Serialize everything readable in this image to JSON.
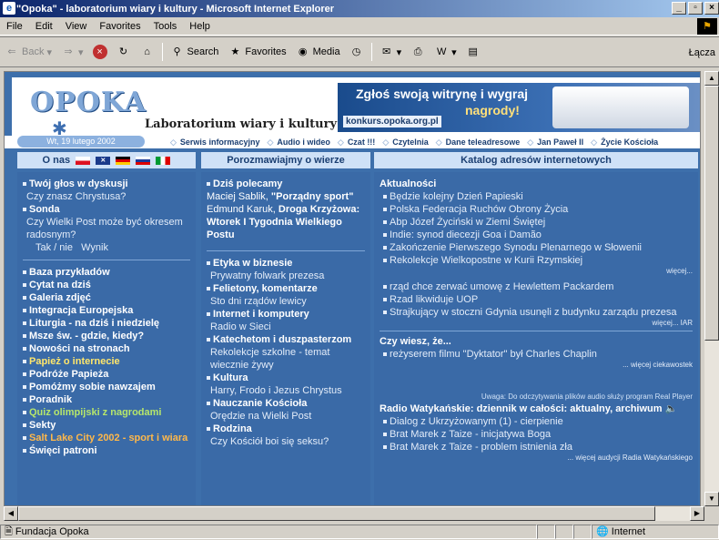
{
  "window": {
    "title": "\"Opoka\" - laboratorium wiary i kultury - Microsoft Internet Explorer",
    "buttons": [
      "_",
      "̅",
      "×"
    ]
  },
  "menubar": [
    "File",
    "Edit",
    "View",
    "Favorites",
    "Tools",
    "Help"
  ],
  "toolbar": {
    "back": "Back",
    "search": "Search",
    "favorites": "Favorites",
    "media": "Media",
    "links": "Łącza"
  },
  "statusbar": {
    "text": "Fundacja Opoka",
    "zone": "Internet"
  },
  "header": {
    "logo": "OPOKA",
    "subtitle": "Laboratorium wiary i kultury",
    "banner_line1": "Zgłoś swoją witrynę i wygraj",
    "banner_line2": "nagrody!",
    "banner_url": "konkurs.opoka.org.pl",
    "date": "Wt, 19 lutego 2002"
  },
  "nav": [
    "Serwis informacyjny",
    "Audio i wideo",
    "Czat !!!",
    "Czytelnia",
    "Dane teleadresowe",
    "Jan Paweł II",
    "Życie Kościoła"
  ],
  "sections": {
    "left": "O nas",
    "middle": "Porozmawiajmy o wierze",
    "right": "Katalog adresów internetowych"
  },
  "left": {
    "discussion_title": "Twój głos w dyskusji",
    "discussion_q": "Czy znasz Chrystusa?",
    "poll_title": "Sonda",
    "poll_q": "Czy Wielki Post może być okresem radosnym?",
    "poll_links": "Tak / nie",
    "poll_result": "Wynik",
    "links": [
      "Baza przykładów",
      "Cytat na dziś",
      "Galeria zdjęć",
      "Integracja Europejska",
      "Liturgia - na dziś i niedzielę",
      "Msze św. - gdzie, kiedy?",
      "Nowości na stronach"
    ],
    "special": "Papież o internecie",
    "links2": [
      "Podróże Papieża",
      "Pomóżmy sobie nawzajem",
      "Poradnik"
    ],
    "quiz": "Quiz olimpijski z nagrodami",
    "sekty": "Sekty",
    "salt": "Salt Lake City 2002 - sport i wiara",
    "saints": "Święci patroni"
  },
  "middle": {
    "rec_title": "Dziś polecamy",
    "rec_author1": "Maciej Sablik,",
    "rec_bold1": "\"Porządny sport\"",
    "rec_author2": "Edmund Karuk,",
    "rec_bold2": "Droga Krzyżowa: Wtorek I Tygodnia Wielkiego Postu",
    "sections": [
      {
        "title": "Etyka w biznesie",
        "sub": "Prywatny folwark prezesa"
      },
      {
        "title": "Felietony, komentarze",
        "sub": "Sto dni rządów lewicy"
      },
      {
        "title": "Internet i komputery",
        "sub": "Radio w Sieci"
      },
      {
        "title": "Katechetom i duszpasterzom",
        "sub": "Rekolekcje szkolne - temat wiecznie żywy"
      },
      {
        "title": "Kultura",
        "sub": "Harry, Frodo i Jezus Chrystus"
      },
      {
        "title": "Nauczanie Kościoła",
        "sub": "Orędzie na Wielki Post"
      },
      {
        "title": "Rodzina",
        "sub": "Czy Kościół boi się seksu?"
      }
    ]
  },
  "right": {
    "news_title": "Aktualności",
    "news": [
      "Będzie kolejny Dzień Papieski",
      "Polska Federacja Ruchów Obrony Życia",
      "Abp Józef Życiński w Ziemi Świętej",
      "Indie: synod diecezji Goa i Damão",
      "Zakończenie Pierwszego Synodu Plenarnego w Słowenii",
      "Rekolekcje Wielkopostne w Kurii Rzymskiej"
    ],
    "more1": "więcej...",
    "news2": [
      "rząd chce zerwać umowę z Hewlettem Packardem",
      "Rzad likwiduje UOP",
      "Strajkujący w stoczni Gdynia usunęli z budynku zarządu prezesa"
    ],
    "more2": "więcej... IAR",
    "know_title": "Czy wiesz, że...",
    "know_item": "reżyserem filmu \"Dyktator\" był Charles Chaplin",
    "more3": "... więcej ciekawostek",
    "audio_note": "Uwaga: Do odczytywania plików audio służy program Real Player",
    "radio_title": "Radio Watykańskie: dziennik w całości: aktualny, archiwum",
    "radio": [
      "Dialog z Ukrzyżowanym (1) - cierpienie",
      "Brat Marek z Taize - inicjatywa Boga",
      "Brat Marek z Taize - problem istnienia zła"
    ],
    "more4": "... więcej audycji Radia Watykańskiego"
  },
  "colors": {
    "page_bg": "#3d6fab",
    "column_bg": "#3a6aa7",
    "section_bar": "#cfe1f7",
    "accent_orange": "#ffb84a",
    "accent_green": "#b6e66b"
  }
}
